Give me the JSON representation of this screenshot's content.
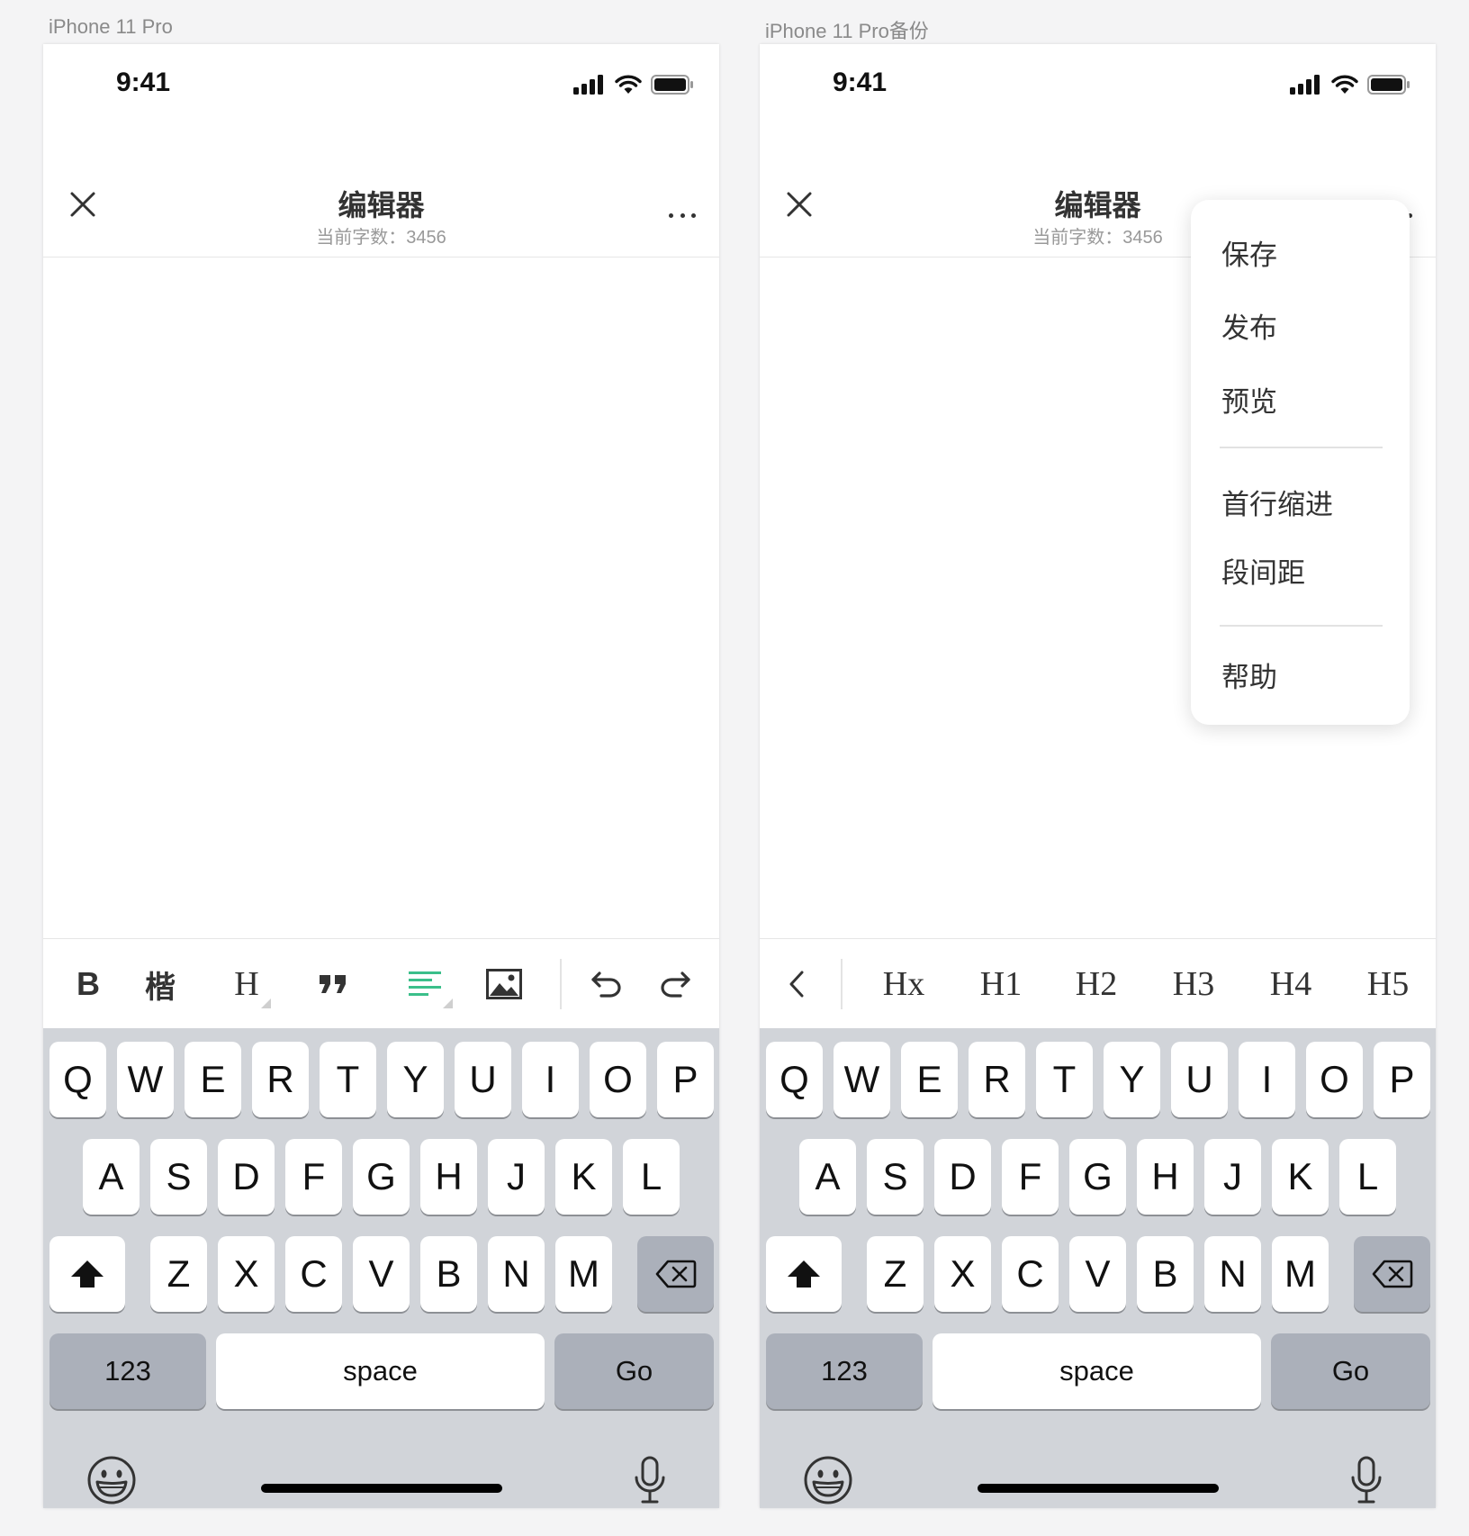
{
  "artboards": [
    "iPhone 11 Pro",
    "iPhone 11 Pro备份"
  ],
  "status_bar": {
    "time": "9:41"
  },
  "nav": {
    "title": "编辑器",
    "subtitle": "当前字数：3456"
  },
  "toolbar": {
    "bold": "B",
    "font": "楷",
    "heading": "H"
  },
  "heading_levels": [
    "Hx",
    "H1",
    "H2",
    "H3",
    "H4",
    "H5"
  ],
  "keyboard": {
    "row1": [
      "Q",
      "W",
      "E",
      "R",
      "T",
      "Y",
      "U",
      "I",
      "O",
      "P"
    ],
    "row2": [
      "A",
      "S",
      "D",
      "F",
      "G",
      "H",
      "J",
      "K",
      "L"
    ],
    "row3": [
      "Z",
      "X",
      "C",
      "V",
      "B",
      "N",
      "M"
    ],
    "numbers": "123",
    "space": "space",
    "go": "Go"
  },
  "menu": {
    "group1": [
      "保存",
      "发布",
      "预览"
    ],
    "group2": [
      "首行缩进",
      "段间距"
    ],
    "group3": [
      "帮助"
    ]
  },
  "colors": {
    "align_icon": "#3bbf8a"
  },
  "icons": [
    "close-icon",
    "more-icon",
    "bold-icon",
    "kai-font-icon",
    "heading-icon",
    "quote-icon",
    "align-icon",
    "image-icon",
    "undo-icon",
    "redo-icon",
    "back-icon",
    "shift-icon",
    "backspace-icon",
    "emoji-icon",
    "mic-icon",
    "signal-icon",
    "wifi-icon",
    "battery-icon"
  ]
}
